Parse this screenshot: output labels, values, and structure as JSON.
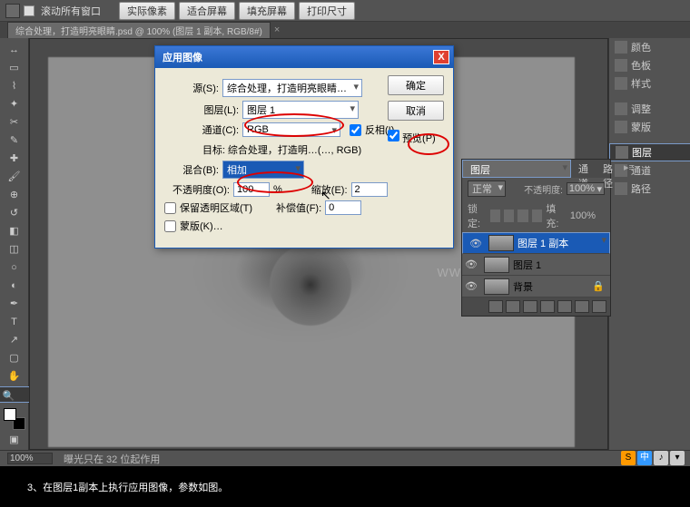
{
  "optbar": {
    "scroll_label": "滚动所有窗口",
    "b1": "实际像素",
    "b2": "适合屏幕",
    "b3": "填充屏幕",
    "b4": "打印尺寸"
  },
  "doc": {
    "title": "综合处理，打造明亮眼睛.psd @ 100% (图层 1 副本, RGB/8#)"
  },
  "dialog": {
    "title": "应用图像",
    "src_label": "源(S):",
    "src_value": "综合处理，打造明亮眼睛…",
    "layer_label": "图层(L):",
    "layer_value": "图层 1",
    "channel_label": "通道(C):",
    "channel_value": "RGB",
    "invert_label": "反相(I)",
    "target_label": "目标:",
    "target_value": "综合处理，打造明…(…, RGB)",
    "blend_label": "混合(B):",
    "blend_value": "相加",
    "opacity_label": "不透明度(O):",
    "opacity_value": "100",
    "opacity_pct": "%",
    "scale_label": "缩放(E):",
    "scale_value": "2",
    "preserve_label": "保留透明区域(T)",
    "offset_label": "补偿值(F):",
    "offset_value": "0",
    "mask_label": "蒙版(K)…",
    "ok": "确定",
    "cancel": "取消",
    "preview": "预览(P)"
  },
  "rpanel": {
    "color": "颜色",
    "swatch": "色板",
    "style": "样式",
    "adjust": "调整",
    "mask": "蒙版",
    "layers": "图层",
    "channel": "通道",
    "path": "路径"
  },
  "layers": {
    "tab1": "图层",
    "tab2": "通道",
    "tab3": "路径",
    "mode": "正常",
    "opacity_lbl": "不透明度:",
    "opacity": "100%",
    "lock_lbl": "锁定:",
    "fill_lbl": "填充:",
    "fill": "100%",
    "l1": "图层 1 副本",
    "l2": "图层 1",
    "l3": "背景"
  },
  "status": {
    "zoom": "100%",
    "exposure": "曝光只在 32 位起作用"
  },
  "watermark": "WWW.MISSYUAN.COM",
  "caption": "3、在图层1副本上执行应用图像，参数如图。",
  "tray": {
    "a": "S",
    "b": "中",
    "c": "♪",
    "d": "▾"
  }
}
